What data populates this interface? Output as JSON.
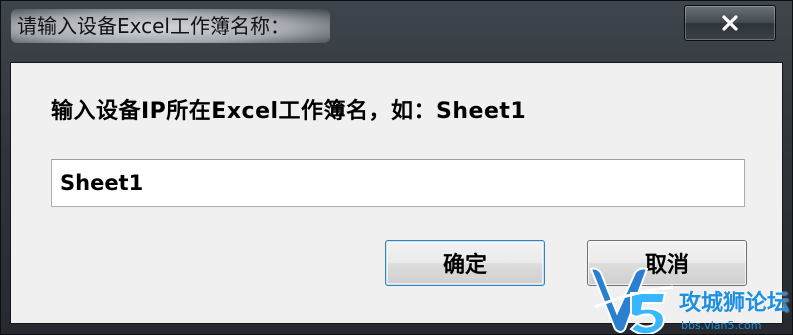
{
  "window": {
    "title": "请输入设备Excel工作簿名称：",
    "close_icon": "close-icon"
  },
  "dialog": {
    "prompt": "输入设备IP所在Excel工作簿名，如：Sheet1",
    "input_value": "Sheet1",
    "ok_label": "确定",
    "cancel_label": "取消"
  },
  "watermark": {
    "logo": "V5",
    "text": "攻城狮论坛",
    "url": "bbs.vlan5.com"
  },
  "colors": {
    "titlebar": "#30353b",
    "client_bg": "#f0f0f0",
    "watermark_blue": "#1f8fe0"
  }
}
